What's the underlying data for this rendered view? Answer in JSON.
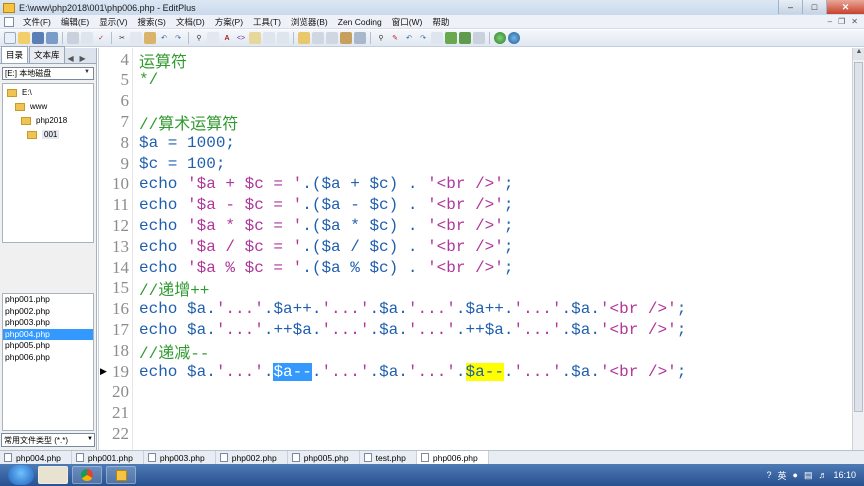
{
  "window": {
    "title": "E:\\www\\php2018\\001\\php006.php - EditPlus"
  },
  "menu": {
    "items": [
      "文件(F)",
      "编辑(E)",
      "显示(V)",
      "搜索(S)",
      "文档(D)",
      "方案(P)",
      "工具(T)",
      "浏览器(B)",
      "Zen Coding",
      "窗口(W)",
      "帮助"
    ]
  },
  "sidebar": {
    "tabs": [
      "目录",
      "文本库"
    ],
    "drive": "[E:] 本地磁盘",
    "folders": [
      "E:\\",
      "www",
      "php2018",
      "001"
    ],
    "files": [
      "php001.php",
      "php002.php",
      "php003.php",
      "php004.php",
      "php005.php",
      "php006.php"
    ],
    "selected_file": "php004.php",
    "filetype": "常用文件类型 (*.*)"
  },
  "editor": {
    "line_numbers": [
      "4",
      "5",
      "6",
      "7",
      "8",
      "9",
      "10",
      "11",
      "12",
      "13",
      "14",
      "15",
      "16",
      "17",
      "18",
      "19",
      "20",
      "21",
      "22"
    ],
    "lines": [
      {
        "num": "4",
        "parts": [
          {
            "t": "运算符",
            "c": "cm"
          }
        ]
      },
      {
        "num": "5",
        "parts": [
          {
            "t": "*/",
            "c": "cm"
          }
        ]
      },
      {
        "num": "6",
        "parts": []
      },
      {
        "num": "7",
        "parts": [
          {
            "t": "//算术运算符",
            "c": "cm"
          }
        ]
      },
      {
        "num": "8",
        "parts": [
          {
            "t": "$a",
            "c": "var"
          },
          {
            "t": " = ",
            "c": "op"
          },
          {
            "t": "1000",
            "c": "num"
          },
          {
            "t": ";",
            "c": "op"
          }
        ]
      },
      {
        "num": "9",
        "parts": [
          {
            "t": "$c",
            "c": "var"
          },
          {
            "t": " = ",
            "c": "op"
          },
          {
            "t": "100",
            "c": "num"
          },
          {
            "t": ";",
            "c": "op"
          }
        ]
      },
      {
        "num": "10",
        "parts": [
          {
            "t": "echo ",
            "c": "kw"
          },
          {
            "t": "'$a + $c = '",
            "c": "str"
          },
          {
            "t": ".($a + $c) . ",
            "c": "op"
          },
          {
            "t": "'<br />'",
            "c": "str"
          },
          {
            "t": ";",
            "c": "op"
          }
        ]
      },
      {
        "num": "11",
        "parts": [
          {
            "t": "echo ",
            "c": "kw"
          },
          {
            "t": "'$a - $c = '",
            "c": "str"
          },
          {
            "t": ".($a - $c) . ",
            "c": "op"
          },
          {
            "t": "'<br />'",
            "c": "str"
          },
          {
            "t": ";",
            "c": "op"
          }
        ]
      },
      {
        "num": "12",
        "parts": [
          {
            "t": "echo ",
            "c": "kw"
          },
          {
            "t": "'$a * $c = '",
            "c": "str"
          },
          {
            "t": ".($a * $c) . ",
            "c": "op"
          },
          {
            "t": "'<br />'",
            "c": "str"
          },
          {
            "t": ";",
            "c": "op"
          }
        ]
      },
      {
        "num": "13",
        "parts": [
          {
            "t": "echo ",
            "c": "kw"
          },
          {
            "t": "'$a / $c = '",
            "c": "str"
          },
          {
            "t": ".($a / $c) . ",
            "c": "op"
          },
          {
            "t": "'<br />'",
            "c": "str"
          },
          {
            "t": ";",
            "c": "op"
          }
        ]
      },
      {
        "num": "14",
        "parts": [
          {
            "t": "echo ",
            "c": "kw"
          },
          {
            "t": "'$a % $c = '",
            "c": "str"
          },
          {
            "t": ".($a % $c) . ",
            "c": "op"
          },
          {
            "t": "'<br />'",
            "c": "str"
          },
          {
            "t": ";",
            "c": "op"
          }
        ]
      },
      {
        "num": "15",
        "parts": [
          {
            "t": "//递增++",
            "c": "cm"
          }
        ]
      },
      {
        "num": "16",
        "parts": [
          {
            "t": "echo ",
            "c": "kw"
          },
          {
            "t": "$a.",
            "c": "var"
          },
          {
            "t": "'...'",
            "c": "str"
          },
          {
            "t": ".$a++.",
            "c": "var"
          },
          {
            "t": "'...'",
            "c": "str"
          },
          {
            "t": ".$a.",
            "c": "var"
          },
          {
            "t": "'...'",
            "c": "str"
          },
          {
            "t": ".$a++.",
            "c": "var"
          },
          {
            "t": "'...'",
            "c": "str"
          },
          {
            "t": ".$a.",
            "c": "var"
          },
          {
            "t": "'<br />'",
            "c": "str"
          },
          {
            "t": ";",
            "c": "op"
          }
        ]
      },
      {
        "num": "17",
        "parts": [
          {
            "t": "echo ",
            "c": "kw"
          },
          {
            "t": "$a.",
            "c": "var"
          },
          {
            "t": "'...'",
            "c": "str"
          },
          {
            "t": ".++$a.",
            "c": "var"
          },
          {
            "t": "'...'",
            "c": "str"
          },
          {
            "t": ".$a.",
            "c": "var"
          },
          {
            "t": "'...'",
            "c": "str"
          },
          {
            "t": ".++$a.",
            "c": "var"
          },
          {
            "t": "'...'",
            "c": "str"
          },
          {
            "t": ".$a.",
            "c": "var"
          },
          {
            "t": "'<br />'",
            "c": "str"
          },
          {
            "t": ";",
            "c": "op"
          }
        ]
      },
      {
        "num": "18",
        "parts": [
          {
            "t": "//递减--",
            "c": "cm"
          }
        ]
      },
      {
        "num": "19",
        "parts": [
          {
            "t": "echo ",
            "c": "kw"
          },
          {
            "t": "$a.",
            "c": "var"
          },
          {
            "t": "'...'",
            "c": "str"
          },
          {
            "t": ".",
            "c": "op"
          },
          {
            "t": "$a--",
            "c": "hl-sel"
          },
          {
            "t": ".",
            "c": "op"
          },
          {
            "t": "'...'",
            "c": "str"
          },
          {
            "t": ".$a.",
            "c": "var"
          },
          {
            "t": "'...'",
            "c": "str"
          },
          {
            "t": ".",
            "c": "op"
          },
          {
            "t": "$a--",
            "c": "hl-yel"
          },
          {
            "t": ".",
            "c": "op"
          },
          {
            "t": "'...'",
            "c": "str"
          },
          {
            "t": ".$a.",
            "c": "var"
          },
          {
            "t": "'<br />'",
            "c": "str"
          },
          {
            "t": ";",
            "c": "op"
          }
        ]
      },
      {
        "num": "20",
        "parts": []
      },
      {
        "num": "21",
        "parts": []
      },
      {
        "num": "22",
        "parts": []
      }
    ]
  },
  "doc_tabs": [
    "php004.php",
    "php001.php",
    "php003.php",
    "php002.php",
    "php005.php",
    "test.php",
    "php006.php"
  ],
  "active_doc_tab": "php006.php",
  "taskbar": {
    "clock": "16:10",
    "ime": "英"
  }
}
